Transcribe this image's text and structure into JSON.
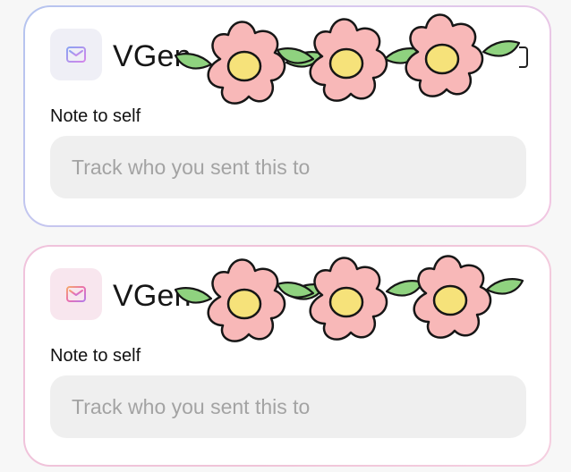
{
  "cards": [
    {
      "app_name": "VGen",
      "note_label": "Note to self",
      "note_placeholder": "Track who you sent this to",
      "icon": "envelope-icon",
      "accent": "#c38be0"
    },
    {
      "app_name": "VGen",
      "note_label": "Note to self",
      "note_placeholder": "Track who you sent this to",
      "icon": "envelope-icon",
      "accent": "#e39ad0"
    }
  ],
  "decoration": {
    "sticker": "pink-flower-crown",
    "flower_petal": "#f8b8b8",
    "flower_center": "#f6e27a",
    "leaf": "#8fd27f"
  }
}
